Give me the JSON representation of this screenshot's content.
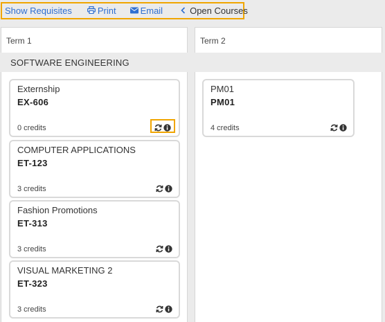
{
  "toolbar": {
    "show_requisites": "Show Requisites",
    "print": "Print",
    "email": "Email",
    "open_courses": "Open Courses"
  },
  "terms": [
    {
      "label": "Term 1"
    },
    {
      "label": "Term 2"
    }
  ],
  "program": {
    "name": "SOFTWARE ENGINEERING"
  },
  "term1_courses": [
    {
      "title": "Externship",
      "code": "EX-606",
      "credits": "0 credits"
    },
    {
      "title": "COMPUTER APPLICATIONS",
      "code": "ET-123",
      "credits": "3 credits"
    },
    {
      "title": "Fashion Promotions",
      "code": "ET-313",
      "credits": "3 credits"
    },
    {
      "title": "VISUAL MARKETING 2",
      "code": "ET-323",
      "credits": "3 credits"
    }
  ],
  "term2_courses": [
    {
      "title": "PM01",
      "code": "PM01",
      "credits": "4 credits"
    }
  ],
  "colors": {
    "link": "#2f6fd1",
    "highlight": "#f0a500",
    "background": "#ebebeb",
    "card_border": "#d9d9d9"
  },
  "icons": {
    "print": "printer-icon",
    "email": "envelope-icon",
    "open": "chevron-left-icon",
    "swap": "refresh-icon",
    "info": "info-circle-icon"
  }
}
